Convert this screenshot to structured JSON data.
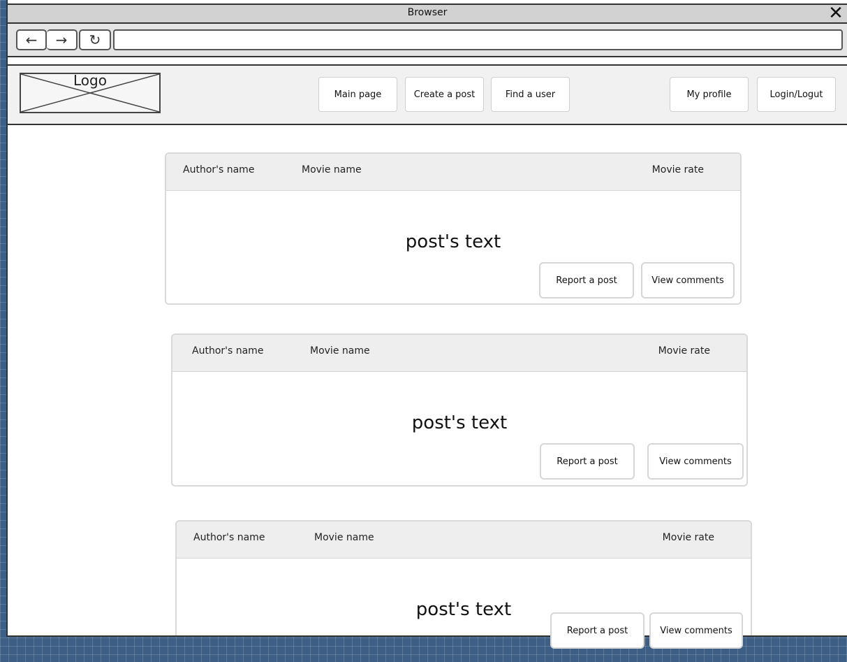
{
  "browser": {
    "title": "Browser",
    "close_glyph": "✕",
    "back_glyph": "←",
    "forward_glyph": "→",
    "reload_glyph": "↻",
    "url": ""
  },
  "header": {
    "logo_label": "Logo",
    "nav_buttons": [
      {
        "label": "Main page"
      },
      {
        "label": "Create a post"
      },
      {
        "label": "Find a user"
      }
    ],
    "my_profile_label": "My profile",
    "login_label": "Login/Logut"
  },
  "posts": [
    {
      "author": "Author's name",
      "movie": "Movie name",
      "rate": "Movie rate",
      "text": "post's text",
      "report_label": "Report a post",
      "comments_label": "View comments"
    },
    {
      "author": "Author's name",
      "movie": "Movie name",
      "rate": "Movie rate",
      "text": "post's text",
      "report_label": "Report a post",
      "comments_label": "View comments"
    },
    {
      "author": "Author's name",
      "movie": "Movie name",
      "rate": "Movie rate",
      "text": "post's text",
      "report_label": "Report a post",
      "comments_label": "View comments"
    }
  ],
  "icons": {
    "back": "arrow-left-icon",
    "forward": "arrow-right-icon",
    "reload": "reload-icon",
    "close": "close-icon",
    "logo": "logo-placeholder-icon"
  },
  "colors": {
    "background": "#3d5f86",
    "titlebar": "#d2d2d2",
    "toolbar": "#e4e4e4",
    "header": "#f1f1f1",
    "card_header": "#eeeeee",
    "border": "#333333"
  }
}
